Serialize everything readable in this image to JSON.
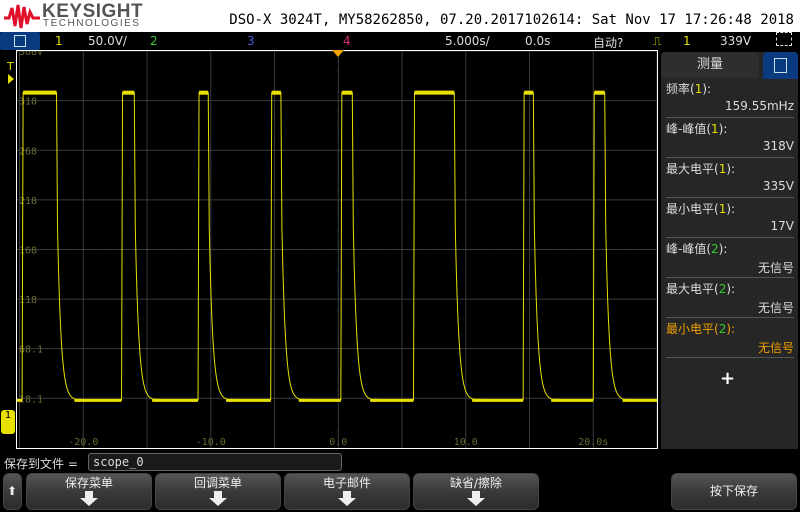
{
  "header": {
    "brand": "KEYSIGHT",
    "brand_sub": "TECHNOLOGIES",
    "title": "DSO-X 3024T, MY58262850, 07.20.2017102614: Sat Nov 17 17:26:48 2018"
  },
  "toolbar": {
    "ch1": "1",
    "ch1_scale": "50.0V/",
    "ch2": "2",
    "ch3": "3",
    "ch4": "4",
    "timebase": "5.000s/",
    "delay": "0.0s",
    "trigger_mode": "自动?",
    "trigger_src": "1",
    "trigger_level": "339V"
  },
  "colors": {
    "ch1": "#e8e000",
    "ch2": "#33cc33",
    "ch3": "#4a5ad8",
    "ch4": "#e0307a",
    "accent": "#0a3a80",
    "trigger": "#f0a000"
  },
  "chart_data": {
    "type": "line",
    "y_tick_labels": [
      "368V",
      "318",
      "268",
      "218",
      "168",
      "118",
      "68.1",
      "18.1"
    ],
    "y_ticks": [
      368,
      318,
      268,
      218,
      168,
      118,
      68.1,
      18.1
    ],
    "x_tick_labels": [
      "-20.0",
      "-10.0",
      "0.0",
      "10.0",
      "20.0s"
    ],
    "x_ticks": [
      -20,
      -10,
      0,
      10,
      20
    ],
    "xlim": [
      -25.2,
      25
    ],
    "ylim": [
      -32,
      368
    ],
    "series": [
      {
        "name": "1",
        "high_v": 326,
        "low_v": 16,
        "pulses": [
          [
            -24.8,
            -22.1
          ],
          [
            -17.0,
            -16.0
          ],
          [
            -11.0,
            -10.2
          ],
          [
            -5.3,
            -4.5
          ],
          [
            0.2,
            1.1
          ],
          [
            5.9,
            9.1
          ],
          [
            14.5,
            15.3
          ],
          [
            20.0,
            20.9
          ]
        ]
      }
    ],
    "grid": true,
    "trigger_marker": "T",
    "ground_marker": "1"
  },
  "measurements": {
    "title": "测量",
    "items": [
      {
        "label": "频率(",
        "ch": "1",
        "end": "):",
        "value": "159.55mHz",
        "cls": "y"
      },
      {
        "label": "峰-峰值(",
        "ch": "1",
        "end": "):",
        "value": "318V",
        "cls": "y"
      },
      {
        "label": "最大电平(",
        "ch": "1",
        "end": "):",
        "value": "335V",
        "cls": "y"
      },
      {
        "label": "最小电平(",
        "ch": "1",
        "end": "):",
        "value": "17V",
        "cls": "y"
      },
      {
        "label": "峰-峰值(",
        "ch": "2",
        "end": "):",
        "value": "无信号",
        "cls": "g"
      },
      {
        "label": "最大电平(",
        "ch": "2",
        "end": "):",
        "value": "无信号",
        "cls": "g"
      },
      {
        "label": "最小电平(",
        "ch": "2",
        "end": "):",
        "value": "无信号",
        "cls": "g",
        "highlight": true
      }
    ],
    "add": "+"
  },
  "softkeys": {
    "save_label": "保存到文件 =",
    "filename": "scope_0",
    "buttons": [
      "保存菜单",
      "回调菜单",
      "电子邮件",
      "缺省/擦除"
    ],
    "press_save": "按下保存"
  }
}
